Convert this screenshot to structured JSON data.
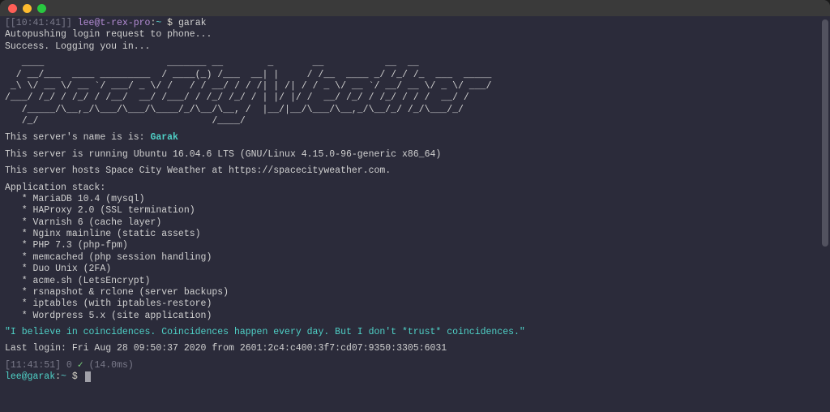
{
  "prompt1": {
    "time": "[10:41:41]",
    "userhost": "lee@t-rex-pro",
    "sep": ":",
    "path": "~",
    "sym": " $ ",
    "cmd": "garak"
  },
  "auth": {
    "l1": "Autopushing login request to phone...",
    "l2": "Success. Logging you in..."
  },
  "ascii": {
    "l1": "   ____                      _______ __        _       __           __  __            ",
    "l2": "  / __/___  ____ _________  / ____(_) /___  __| |     / /__  ____ _/ /_/ /_  ___  _____",
    "l3": " _\\ \\/ __ \\/ __ `/ ___/ _ \\/ /   / / __/ / / /| | /| / / _ \\/ __ `/ __/ __ \\/ _ \\/ ___/",
    "l4": "/___/ /_/ / /_/ / /__/  __/ /___/ / /_/ /_/ / | |/ |/ /  __/ /_/ / /_/ / / /  __/ /    ",
    "l5": "   /_____/\\__,_/\\___/\\___/\\____/_/\\__/\\__, /  |__/|__/\\___/\\__,_/\\__/_/ /_/\\___/_/     ",
    "l6": "   /_/                               /____/                                             "
  },
  "intro": {
    "name_pre": "This server's name is is: ",
    "name": "Garak",
    "os": "This server is running Ubuntu 16.04.6 LTS (GNU/Linux 4.15.0-96-generic x86_64)",
    "hosts": "This server hosts Space City Weather at https://spacecityweather.com."
  },
  "stack": {
    "title": "Application stack:",
    "items": [
      "   * MariaDB 10.4 (mysql)",
      "   * HAProxy 2.0 (SSL termination)",
      "   * Varnish 6 (cache layer)",
      "   * Nginx mainline (static assets)",
      "   * PHP 7.3 (php-fpm)",
      "   * memcached (php session handling)",
      "   * Duo Unix (2FA)",
      "   * acme.sh (LetsEncrypt)",
      "   * rsnapshot & rclone (server backups)",
      "   * iptables (with iptables-restore)",
      "   * Wordpress 5.x (site application)"
    ]
  },
  "quote": "\"I believe in coincidences. Coincidences happen every day. But I don't *trust* coincidences.\"",
  "lastlogin": "Last login: Fri Aug 28 09:50:37 2020 from 2601:2c4:c400:3f7:cd07:9350:3305:6031",
  "status": {
    "time": "[11:41:51]",
    "exit": " 0 ",
    "check": "✓",
    "ms": " (14.0ms)"
  },
  "prompt2": {
    "userhost": "lee@garak",
    "sep": ":",
    "path": "~",
    "sym": " $ "
  }
}
